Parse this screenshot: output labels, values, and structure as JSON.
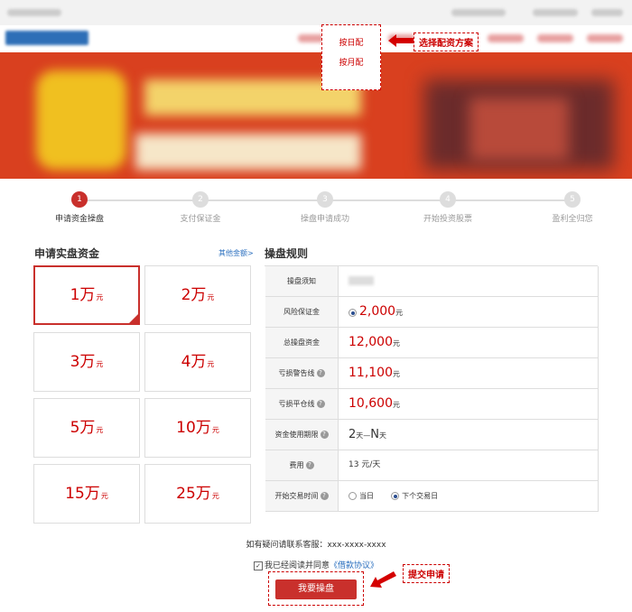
{
  "dropdown": {
    "items": [
      "按日配",
      "按月配"
    ]
  },
  "callouts": {
    "select_plan": "选择配资方案",
    "submit_apply": "提交申请"
  },
  "steps": [
    {
      "num": "1",
      "label": "申请资金操盘"
    },
    {
      "num": "2",
      "label": "支付保证金"
    },
    {
      "num": "3",
      "label": "操盘申请成功"
    },
    {
      "num": "4",
      "label": "开始投资股票"
    },
    {
      "num": "5",
      "label": "盈利全归您"
    }
  ],
  "left": {
    "title": "申请实盘资金",
    "other_link": "其他金额>",
    "amounts": [
      {
        "value": "1万",
        "unit": "元",
        "selected": true
      },
      {
        "value": "2万",
        "unit": "元"
      },
      {
        "value": "3万",
        "unit": "元"
      },
      {
        "value": "4万",
        "unit": "元"
      },
      {
        "value": "5万",
        "unit": "元"
      },
      {
        "value": "10万",
        "unit": "元"
      },
      {
        "value": "15万",
        "unit": "元"
      },
      {
        "value": "25万",
        "unit": "元"
      }
    ]
  },
  "rules": {
    "title": "操盘规则",
    "rows": {
      "notice": {
        "key": "操盘须知"
      },
      "margin": {
        "key": "风险保证金",
        "value": "2,000",
        "unit": "元"
      },
      "total": {
        "key": "总操盘资金",
        "value": "12,000",
        "unit": "元"
      },
      "warn": {
        "key": "亏损警告线",
        "value": "11,100",
        "unit": "元"
      },
      "close": {
        "key": "亏损平仓线",
        "value": "10,600",
        "unit": "元"
      },
      "period": {
        "key": "资金使用期限",
        "v1": "2",
        "u1": "天",
        "sep": "—",
        "v2": "N",
        "u2": "天"
      },
      "fee": {
        "key": "费用",
        "value": "13 元/天"
      },
      "start": {
        "key": "开始交易时间",
        "opt1": "当日",
        "opt2": "下个交易日"
      }
    }
  },
  "footer": {
    "contact": "如有疑问请联系客服：xxx-xxxx-xxxx",
    "agree_text": "我已经阅读并同意",
    "agree_link": "《借款协议》",
    "submit": "我要操盘"
  },
  "colors": {
    "accent": "#c9302c",
    "link": "#2a6fbf"
  }
}
